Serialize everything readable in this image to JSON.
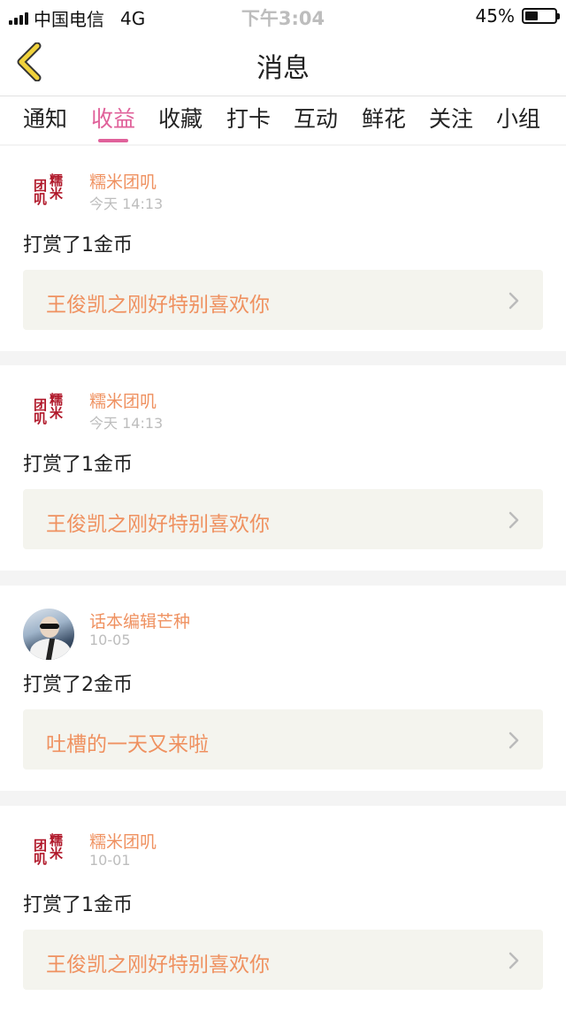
{
  "status_bar": {
    "carrier": "中国电信",
    "network": "4G",
    "time": "下午3:04",
    "battery": "45%",
    "battery_level": 0.45
  },
  "header": {
    "title": "消息",
    "back_icon": "chevron-left-icon",
    "accent": "#e8c93a"
  },
  "tabs": [
    {
      "label": "通知",
      "active": false
    },
    {
      "label": "收益",
      "active": true
    },
    {
      "label": "收藏",
      "active": false
    },
    {
      "label": "打卡",
      "active": false
    },
    {
      "label": "互动",
      "active": false
    },
    {
      "label": "鲜花",
      "active": false
    },
    {
      "label": "关注",
      "active": false
    },
    {
      "label": "小组",
      "active": false
    }
  ],
  "colors": {
    "active_tab": "#e0619a",
    "username": "#ef9160",
    "link_text": "#ef9160"
  },
  "messages": [
    {
      "avatar": "brand-logo",
      "avatar_text": "糯米团叽",
      "username": "糯米团叽",
      "time": "今天 14:13",
      "action": "打赏了1金币",
      "link_text": "王俊凯之刚好特别喜欢你"
    },
    {
      "avatar": "brand-logo",
      "avatar_text": "糯米团叽",
      "username": "糯米团叽",
      "time": "今天 14:13",
      "action": "打赏了1金币",
      "link_text": "王俊凯之刚好特别喜欢你"
    },
    {
      "avatar": "user-photo",
      "username": "话本编辑芒种",
      "time": "10-05",
      "action": "打赏了2金币",
      "link_text": "吐槽的一天又来啦"
    },
    {
      "avatar": "brand-logo",
      "avatar_text": "糯米团叽",
      "username": "糯米团叽",
      "time": "10-01",
      "action": "打赏了1金币",
      "link_text": "王俊凯之刚好特别喜欢你"
    }
  ]
}
